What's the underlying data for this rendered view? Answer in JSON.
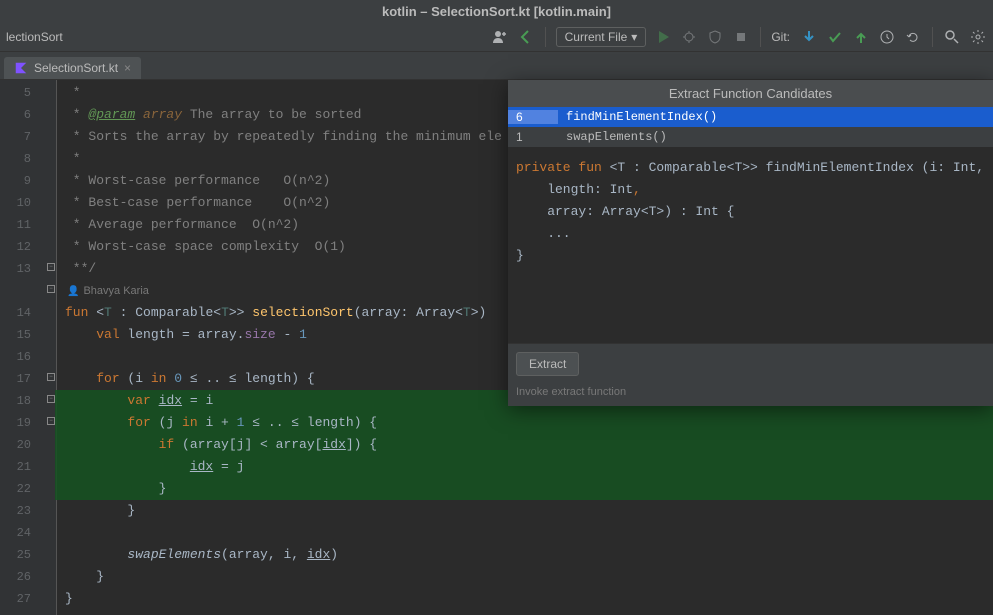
{
  "title": "kotlin – SelectionSort.kt [kotlin.main]",
  "breadcrumb": "lectionSort",
  "runConfig": "Current File",
  "gitLabel": "Git:",
  "tab": {
    "name": "SelectionSort.kt"
  },
  "author": "Bhavya Karia",
  "popup": {
    "title": "Extract Function Candidates",
    "candidates": [
      {
        "count": "6",
        "name": "findMinElementIndex()"
      },
      {
        "count": "1",
        "name": "swapElements()"
      }
    ],
    "preview": {
      "kw_private": "private",
      "kw_fun": "fun",
      "sig1": " <T : Comparable<T>> findMinElementIndex (i: Int,",
      "line2a": "    length: Int",
      "line2b": ",",
      "line3": "    array: Array<T>) : Int {",
      "line4": "    ...",
      "line5": "}"
    },
    "extractLabel": "Extract",
    "hint": "Invoke extract function"
  },
  "lines": [
    5,
    6,
    7,
    8,
    9,
    10,
    11,
    12,
    13,
    14,
    15,
    16,
    17,
    18,
    19,
    20,
    21,
    22,
    23,
    24,
    25,
    26,
    27
  ],
  "comments": {
    "l5": " *",
    "l6a": " * ",
    "l6b": "@param",
    "l6c": " array",
    "l6d": " The array to be sorted",
    "l7": " * Sorts the array by repeatedly finding the minimum ele",
    "l8": " *",
    "l9": " * Worst-case performance   O(n^2)",
    "l10": " * Best-case performance    O(n^2)",
    "l11": " * Average performance  O(n^2)",
    "l12": " * Worst-case space complexity  O(1)",
    "l13": " **/"
  },
  "code": {
    "fun": "fun",
    "T": "T",
    "colon": " : ",
    "Comparable": "Comparable",
    "selectionSort": "selectionSort",
    "arrayParam": "(array: Array<",
    "close14": ">) ",
    "val": "val",
    "length": " length = array.",
    "size": "size",
    "minus1": " - ",
    "one": "1",
    "forKw": "for",
    "i": " (i ",
    "inKw": "in",
    "zero": "0",
    "range1": " ≤ .. ≤ length) {",
    "varKw": "var",
    "idx": "idx",
    "eqI": " = i",
    "j": " (j ",
    "iPlus1a": " i + ",
    "iPlus1b": "1",
    "range2": " ≤ .. ≤ length) {",
    "ifKw": "if",
    "cond1": " (array[j] < array[",
    "cond2": "]) {",
    "idxJ": " = j",
    "rbrace": "}",
    "swapElements": "swapElements",
    "swapArgs1": "(array, i, ",
    "swapArgs2": ")"
  }
}
